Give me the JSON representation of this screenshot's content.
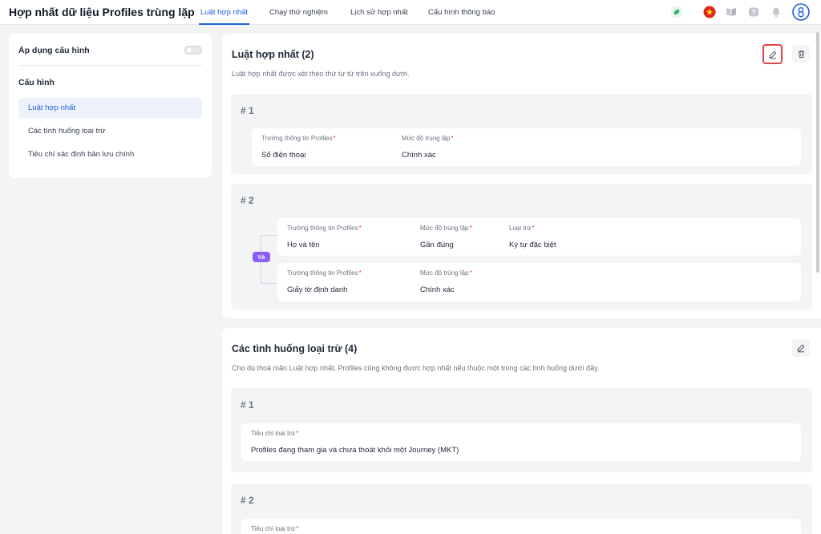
{
  "header": {
    "title": "Hợp nhất dữ liệu Profiles trùng lặp",
    "tabs": [
      {
        "label": "Luật hợp nhất"
      },
      {
        "label": "Chạy thử nghiệm"
      },
      {
        "label": "Lịch sử hợp nhất"
      },
      {
        "label": "Cấu hình thông báo"
      }
    ],
    "active_tab": "Luật hợp nhất",
    "icons": [
      "leaf-icon",
      "vietnam-flag-icon",
      "book-icon",
      "help-icon",
      "bell-icon",
      "user-avatar-icon"
    ]
  },
  "sidebar": {
    "apply_config_label": "Áp dụng cấu hình",
    "apply_config_on": false,
    "section_title": "Cấu hình",
    "items": [
      {
        "label": "Luật hợp nhất"
      },
      {
        "label": "Các tình huống loại trừ"
      },
      {
        "label": "Tiêu chí xác định bản lưu chính"
      }
    ]
  },
  "merge_rules": {
    "title": "Luật hợp nhất (2)",
    "description": "Luật hợp nhất được xét theo thứ tự từ trên xuống dưới.",
    "rules": [
      {
        "number": "# 1",
        "conditions": [
          {
            "field_label": "Trường thông tin Profiles",
            "field_value": "Số điện thoại",
            "level_label": "Mức độ trùng lặp",
            "level_value": "Chính xác"
          }
        ]
      },
      {
        "number": "# 2",
        "connector": "Và",
        "conditions": [
          {
            "field_label": "Trường thông tin Profiles",
            "field_value": "Họ và tên",
            "level_label": "Mức độ trùng lặp",
            "level_value": "Gần đúng",
            "exclude_label": "Loại trừ",
            "exclude_value": "Ký tự đặc biệt"
          },
          {
            "field_label": "Trường thông tin Profiles",
            "field_value": "Giấy tờ định danh",
            "level_label": "Mức độ trùng lặp",
            "level_value": "Chính xác"
          }
        ]
      }
    ]
  },
  "exclusions": {
    "title": "Các tình huống loại trừ (4)",
    "description": "Cho dù thoả mãn Luật hợp nhất, Profiles cũng không được hợp nhất nếu thuộc một trong các tình huống dưới đây.",
    "items": [
      {
        "number": "# 1",
        "label": "Tiêu chí loại trừ",
        "value": "Profiles đang tham gia và chưa thoát khỏi một Journey (MKT)"
      },
      {
        "number": "# 2",
        "label": "Tiêu chí loại trừ",
        "value": ""
      }
    ]
  },
  "colors": {
    "accent": "#1d5fd8",
    "required": "#e04343",
    "and_badge": "#8b5cf6"
  }
}
